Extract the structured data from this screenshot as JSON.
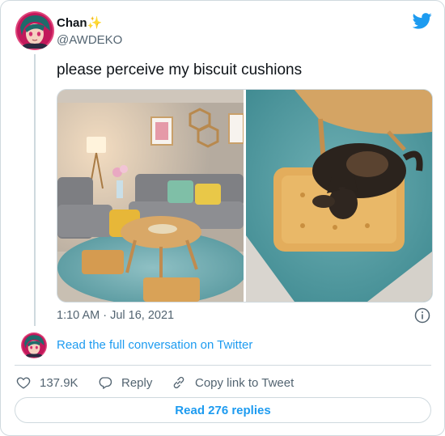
{
  "tweet": {
    "author_name": "Chan",
    "name_emoji": "✨",
    "handle": "@AWDEKO",
    "text": "please perceive my biscuit cushions",
    "timestamp": "1:10 AM · Jul 16, 2021",
    "media": [
      {
        "icon": "living-room-photo"
      },
      {
        "icon": "cat-on-biscuit-cushion-photo"
      }
    ]
  },
  "conversation": {
    "link_text": "Read the full conversation on Twitter"
  },
  "actions": {
    "likes_count": "137.9K",
    "reply_label": "Reply",
    "copy_link_label": "Copy link to Tweet"
  },
  "replies_button": "Read 276 replies",
  "colors": {
    "accent": "#1d9bf0",
    "secondary_text": "#536471",
    "border": "#cfd9de"
  }
}
